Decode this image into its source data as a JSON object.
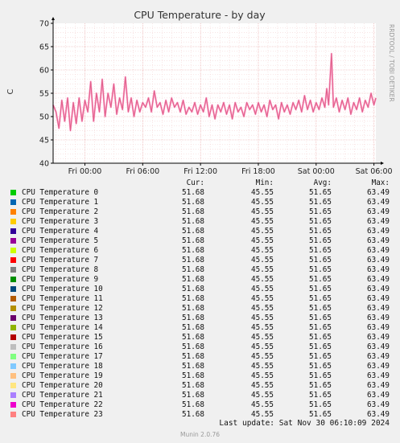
{
  "chart_data": {
    "type": "line",
    "title": "CPU Temperature - by day",
    "ylabel": "C",
    "ylim": [
      40,
      70
    ],
    "yticks": [
      "40",
      "45",
      "50",
      "55",
      "60",
      "65",
      "70"
    ],
    "xticks": [
      "Fri 00:00",
      "Fri 06:00",
      "Fri 12:00",
      "Fri 18:00",
      "Sat 00:00",
      "Sat 06:00"
    ],
    "xlim_hours": [
      -3.3,
      30.2
    ],
    "grid": true,
    "side_label": "RRDTOOL / TOBI OETIKER",
    "series_color": "#e0608a",
    "series_color_light": "#ff8fc0",
    "temperature_points": [
      [
        -3.3,
        52.5
      ],
      [
        -3.0,
        51.0
      ],
      [
        -2.7,
        47.5
      ],
      [
        -2.4,
        53.5
      ],
      [
        -2.1,
        49.0
      ],
      [
        -1.8,
        54.0
      ],
      [
        -1.5,
        47.0
      ],
      [
        -1.2,
        53.0
      ],
      [
        -0.9,
        48.5
      ],
      [
        -0.6,
        54.0
      ],
      [
        -0.3,
        49.0
      ],
      [
        0.0,
        53.5
      ],
      [
        0.3,
        51.0
      ],
      [
        0.6,
        57.5
      ],
      [
        0.9,
        49.0
      ],
      [
        1.2,
        55.0
      ],
      [
        1.5,
        51.0
      ],
      [
        1.8,
        58.0
      ],
      [
        2.1,
        50.0
      ],
      [
        2.4,
        55.0
      ],
      [
        2.7,
        52.0
      ],
      [
        3.0,
        57.0
      ],
      [
        3.3,
        50.5
      ],
      [
        3.6,
        54.0
      ],
      [
        3.9,
        51.5
      ],
      [
        4.2,
        58.5
      ],
      [
        4.5,
        51.0
      ],
      [
        4.8,
        54.0
      ],
      [
        5.1,
        50.0
      ],
      [
        5.4,
        53.5
      ],
      [
        5.7,
        51.0
      ],
      [
        6.0,
        53.0
      ],
      [
        6.3,
        52.0
      ],
      [
        6.6,
        54.0
      ],
      [
        6.9,
        51.0
      ],
      [
        7.2,
        55.5
      ],
      [
        7.5,
        52.0
      ],
      [
        7.8,
        53.0
      ],
      [
        8.1,
        50.5
      ],
      [
        8.4,
        53.5
      ],
      [
        8.7,
        51.0
      ],
      [
        9.0,
        54.0
      ],
      [
        9.3,
        52.0
      ],
      [
        9.6,
        53.0
      ],
      [
        9.9,
        51.0
      ],
      [
        10.2,
        53.5
      ],
      [
        10.5,
        50.5
      ],
      [
        10.8,
        52.0
      ],
      [
        11.1,
        51.0
      ],
      [
        11.4,
        53.0
      ],
      [
        11.7,
        50.5
      ],
      [
        12.0,
        52.5
      ],
      [
        12.3,
        51.0
      ],
      [
        12.6,
        54.0
      ],
      [
        12.9,
        50.0
      ],
      [
        13.2,
        52.5
      ],
      [
        13.5,
        49.5
      ],
      [
        13.8,
        52.5
      ],
      [
        14.1,
        51.0
      ],
      [
        14.4,
        53.0
      ],
      [
        14.7,
        50.5
      ],
      [
        15.0,
        52.5
      ],
      [
        15.3,
        49.5
      ],
      [
        15.6,
        53.0
      ],
      [
        15.9,
        51.0
      ],
      [
        16.2,
        52.0
      ],
      [
        16.5,
        50.0
      ],
      [
        16.8,
        53.0
      ],
      [
        17.1,
        51.5
      ],
      [
        17.4,
        52.5
      ],
      [
        17.7,
        50.5
      ],
      [
        18.0,
        53.0
      ],
      [
        18.3,
        51.0
      ],
      [
        18.6,
        52.5
      ],
      [
        18.9,
        50.0
      ],
      [
        19.2,
        53.5
      ],
      [
        19.5,
        51.5
      ],
      [
        19.8,
        52.5
      ],
      [
        20.1,
        49.5
      ],
      [
        20.4,
        53.0
      ],
      [
        20.7,
        51.0
      ],
      [
        21.0,
        52.5
      ],
      [
        21.3,
        50.5
      ],
      [
        21.6,
        53.0
      ],
      [
        21.9,
        51.5
      ],
      [
        22.2,
        53.5
      ],
      [
        22.5,
        51.0
      ],
      [
        22.8,
        54.5
      ],
      [
        23.1,
        51.5
      ],
      [
        23.4,
        53.5
      ],
      [
        23.7,
        51.0
      ],
      [
        24.0,
        53.0
      ],
      [
        24.3,
        51.5
      ],
      [
        24.6,
        54.0
      ],
      [
        24.9,
        52.0
      ],
      [
        25.1,
        56.0
      ],
      [
        25.3,
        52.5
      ],
      [
        25.6,
        63.5
      ],
      [
        25.8,
        52.0
      ],
      [
        26.1,
        54.0
      ],
      [
        26.4,
        51.0
      ],
      [
        26.7,
        53.5
      ],
      [
        27.0,
        51.5
      ],
      [
        27.3,
        54.0
      ],
      [
        27.6,
        50.5
      ],
      [
        27.9,
        53.0
      ],
      [
        28.2,
        51.5
      ],
      [
        28.5,
        54.0
      ],
      [
        28.8,
        51.0
      ],
      [
        29.1,
        53.5
      ],
      [
        29.4,
        52.0
      ],
      [
        29.7,
        55.0
      ],
      [
        30.0,
        52.5
      ],
      [
        30.2,
        54.0
      ]
    ],
    "legend_headers": {
      "cur": "Cur:",
      "min": "Min:",
      "avg": "Avg:",
      "max": "Max:"
    },
    "series": [
      {
        "name": "CPU Temperature 0",
        "color": "#00cc00",
        "cur": "51.68",
        "min": "45.55",
        "avg": "51.65",
        "max": "63.49"
      },
      {
        "name": "CPU Temperature 1",
        "color": "#0066b3",
        "cur": "51.68",
        "min": "45.55",
        "avg": "51.65",
        "max": "63.49"
      },
      {
        "name": "CPU Temperature 2",
        "color": "#ff8000",
        "cur": "51.68",
        "min": "45.55",
        "avg": "51.65",
        "max": "63.49"
      },
      {
        "name": "CPU Temperature 3",
        "color": "#ffcc00",
        "cur": "51.68",
        "min": "45.55",
        "avg": "51.65",
        "max": "63.49"
      },
      {
        "name": "CPU Temperature 4",
        "color": "#330099",
        "cur": "51.68",
        "min": "45.55",
        "avg": "51.65",
        "max": "63.49"
      },
      {
        "name": "CPU Temperature 5",
        "color": "#990099",
        "cur": "51.68",
        "min": "45.55",
        "avg": "51.65",
        "max": "63.49"
      },
      {
        "name": "CPU Temperature 6",
        "color": "#ccff00",
        "cur": "51.68",
        "min": "45.55",
        "avg": "51.65",
        "max": "63.49"
      },
      {
        "name": "CPU Temperature 7",
        "color": "#ff0000",
        "cur": "51.68",
        "min": "45.55",
        "avg": "51.65",
        "max": "63.49"
      },
      {
        "name": "CPU Temperature 8",
        "color": "#808080",
        "cur": "51.68",
        "min": "45.55",
        "avg": "51.65",
        "max": "63.49"
      },
      {
        "name": "CPU Temperature 9",
        "color": "#008f00",
        "cur": "51.68",
        "min": "45.55",
        "avg": "51.65",
        "max": "63.49"
      },
      {
        "name": "CPU Temperature 10",
        "color": "#00487d",
        "cur": "51.68",
        "min": "45.55",
        "avg": "51.65",
        "max": "63.49"
      },
      {
        "name": "CPU Temperature 11",
        "color": "#b35a00",
        "cur": "51.68",
        "min": "45.55",
        "avg": "51.65",
        "max": "63.49"
      },
      {
        "name": "CPU Temperature 12",
        "color": "#b38f00",
        "cur": "51.68",
        "min": "45.55",
        "avg": "51.65",
        "max": "63.49"
      },
      {
        "name": "CPU Temperature 13",
        "color": "#6b006b",
        "cur": "51.68",
        "min": "45.55",
        "avg": "51.65",
        "max": "63.49"
      },
      {
        "name": "CPU Temperature 14",
        "color": "#8fb300",
        "cur": "51.68",
        "min": "45.55",
        "avg": "51.65",
        "max": "63.49"
      },
      {
        "name": "CPU Temperature 15",
        "color": "#b30000",
        "cur": "51.68",
        "min": "45.55",
        "avg": "51.65",
        "max": "63.49"
      },
      {
        "name": "CPU Temperature 16",
        "color": "#bebebe",
        "cur": "51.68",
        "min": "45.55",
        "avg": "51.65",
        "max": "63.49"
      },
      {
        "name": "CPU Temperature 17",
        "color": "#80ff80",
        "cur": "51.68",
        "min": "45.55",
        "avg": "51.65",
        "max": "63.49"
      },
      {
        "name": "CPU Temperature 18",
        "color": "#80c9ff",
        "cur": "51.68",
        "min": "45.55",
        "avg": "51.65",
        "max": "63.49"
      },
      {
        "name": "CPU Temperature 19",
        "color": "#ffc080",
        "cur": "51.68",
        "min": "45.55",
        "avg": "51.65",
        "max": "63.49"
      },
      {
        "name": "CPU Temperature 20",
        "color": "#ffe680",
        "cur": "51.68",
        "min": "45.55",
        "avg": "51.65",
        "max": "63.49"
      },
      {
        "name": "CPU Temperature 21",
        "color": "#aa80ff",
        "cur": "51.68",
        "min": "45.55",
        "avg": "51.65",
        "max": "63.49"
      },
      {
        "name": "CPU Temperature 22",
        "color": "#ee00cc",
        "cur": "51.68",
        "min": "45.55",
        "avg": "51.65",
        "max": "63.49"
      },
      {
        "name": "CPU Temperature 23",
        "color": "#ff8080",
        "cur": "51.68",
        "min": "45.55",
        "avg": "51.65",
        "max": "63.49"
      }
    ]
  },
  "footer": {
    "last_update": "Last update:  Sat Nov 30 06:10:09 2024",
    "version": "Munin 2.0.76"
  }
}
